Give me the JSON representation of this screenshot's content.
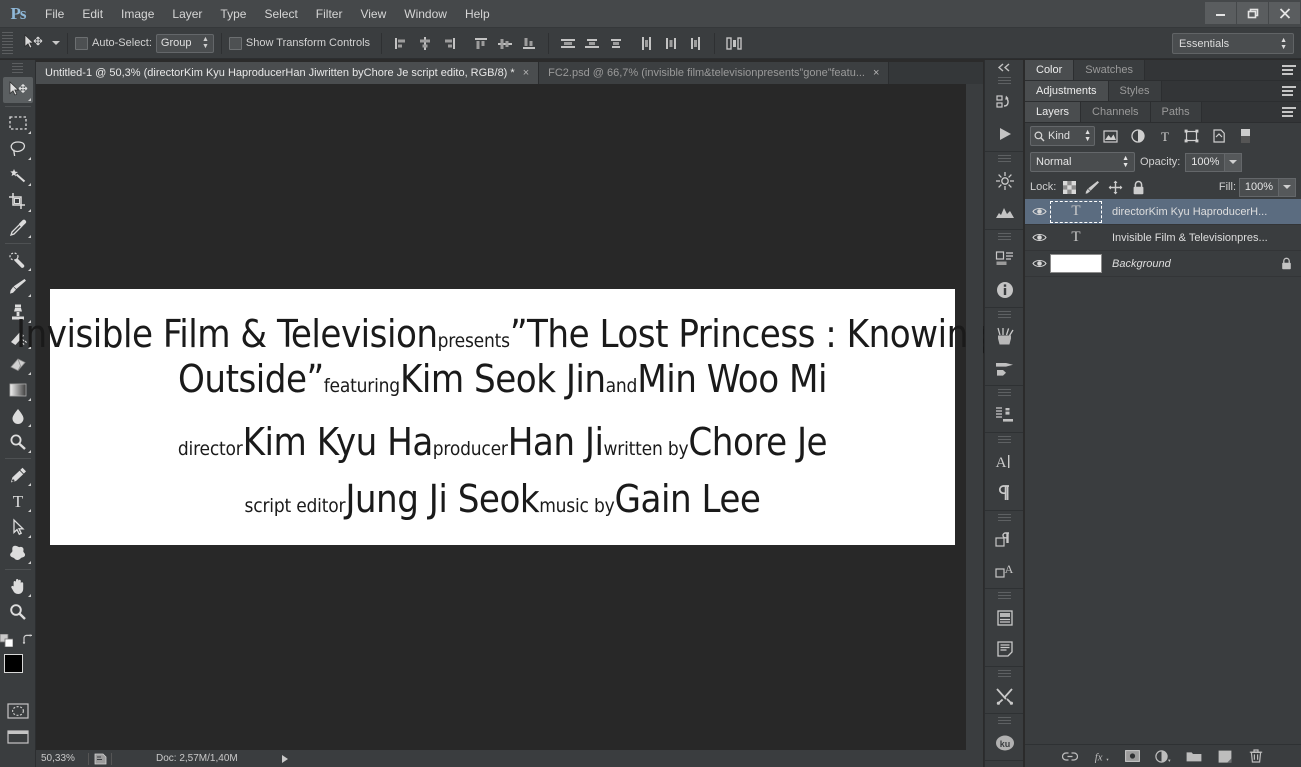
{
  "app": {
    "name": "Ps",
    "logo_text": "Ps"
  },
  "menubar": {
    "items": [
      "File",
      "Edit",
      "Image",
      "Layer",
      "Type",
      "Select",
      "Filter",
      "View",
      "Window",
      "Help"
    ]
  },
  "window_controls": {
    "minimize": "minimize-icon",
    "restore": "restore-icon",
    "close": "close-icon"
  },
  "options_bar": {
    "tool": "move-tool",
    "auto_select_label": "Auto-Select:",
    "auto_select_checked": false,
    "group_value": "Group",
    "show_transform_label": "Show Transform Controls",
    "show_transform_checked": false,
    "align_icons": [
      "align-left-edges-icon",
      "align-horizontal-centers-icon",
      "align-right-edges-icon",
      "align-top-edges-icon",
      "align-vertical-centers-icon",
      "align-bottom-edges-icon",
      "distribute-top-edges-icon",
      "distribute-vertical-centers-icon",
      "distribute-bottom-edges-icon",
      "distribute-left-edges-icon",
      "distribute-horizontal-centers-icon",
      "distribute-right-edges-icon",
      "auto-align-layers-icon"
    ],
    "workspace": "Essentials"
  },
  "tabs": [
    {
      "label": "Untitled-1 @ 50,3%  (directorKim Kyu HaproducerHan Jiwritten byChore Je script edito, RGB/8) *",
      "active": true,
      "close": "×"
    },
    {
      "label": "FC2.psd @ 66,7% (invisible film&televisionpresents”gone”featu...",
      "active": false,
      "close": "×"
    }
  ],
  "toolbar": {
    "tools": [
      {
        "name": "move-tool",
        "selected": true,
        "has_flyout": true
      },
      {
        "name": "rectangular-marquee-tool",
        "selected": false,
        "has_flyout": true
      },
      {
        "name": "lasso-tool",
        "selected": false,
        "has_flyout": true
      },
      {
        "name": "magic-wand-tool",
        "selected": false,
        "has_flyout": true
      },
      {
        "name": "crop-tool",
        "selected": false,
        "has_flyout": true
      },
      {
        "name": "eyedropper-tool",
        "selected": false,
        "has_flyout": true
      },
      {
        "name": "spot-healing-brush-tool",
        "selected": false,
        "has_flyout": true
      },
      {
        "name": "brush-tool",
        "selected": false,
        "has_flyout": true
      },
      {
        "name": "clone-stamp-tool",
        "selected": false,
        "has_flyout": true
      },
      {
        "name": "history-brush-tool",
        "selected": false,
        "has_flyout": true
      },
      {
        "name": "eraser-tool",
        "selected": false,
        "has_flyout": true
      },
      {
        "name": "gradient-tool",
        "selected": false,
        "has_flyout": true
      },
      {
        "name": "blur-tool",
        "selected": false,
        "has_flyout": true
      },
      {
        "name": "dodge-tool",
        "selected": false,
        "has_flyout": true
      },
      {
        "name": "pen-tool",
        "selected": false,
        "has_flyout": true
      },
      {
        "name": "horizontal-type-tool",
        "selected": false,
        "has_flyout": true
      },
      {
        "name": "path-selection-tool",
        "selected": false,
        "has_flyout": true
      },
      {
        "name": "custom-shape-tool",
        "selected": false,
        "has_flyout": true
      },
      {
        "name": "hand-tool",
        "selected": false,
        "has_flyout": true
      },
      {
        "name": "zoom-tool",
        "selected": false,
        "has_flyout": false
      }
    ],
    "foreground_color": "#000000",
    "background_color": "#ffffff",
    "quick_mask": "quick-mask-icon",
    "screen_mode": "screen-mode-icon"
  },
  "canvas": {
    "background_color": "#282828",
    "artboard_color": "#ffffff",
    "credits_lines": [
      [
        {
          "text": "Invisible Film & Television",
          "size": "big"
        },
        {
          "text": "presents",
          "size": "small"
        },
        {
          "text": "”The Lost Princess : Knowing",
          "size": "big"
        }
      ],
      [
        {
          "text": "Outside”",
          "size": "big"
        },
        {
          "text": "featuring",
          "size": "small"
        },
        {
          "text": "Kim Seok Jin",
          "size": "big"
        },
        {
          "text": "and",
          "size": "small"
        },
        {
          "text": "Min Woo Mi",
          "size": "big"
        }
      ],
      [
        {
          "text": "director",
          "size": "small"
        },
        {
          "text": "Kim Kyu Ha",
          "size": "big"
        },
        {
          "text": "producer",
          "size": "small"
        },
        {
          "text": "Han Ji",
          "size": "big"
        },
        {
          "text": "written by",
          "size": "small"
        },
        {
          "text": "Chore Je",
          "size": "big"
        }
      ],
      [
        {
          "text": "script editor",
          "size": "small"
        },
        {
          "text": "Jung Ji Seok",
          "size": "big"
        },
        {
          "text": "music by",
          "size": "small"
        },
        {
          "text": "Gain Lee",
          "size": "big"
        }
      ]
    ]
  },
  "statusbar": {
    "zoom": "50,33%",
    "doc_info": "Doc: 2,57M/1,40M"
  },
  "icon_dock": {
    "collapse": "collapse-panels-icon",
    "groups": [
      [
        "mini-bridge-icon",
        "timeline-play-icon"
      ],
      [
        "history-icon",
        "histogram-icon"
      ],
      [
        "properties-icon",
        "info-icon"
      ],
      [
        "brush-presets-icon",
        "brush-icon"
      ],
      [
        "clone-source-icon"
      ],
      [
        "character-icon",
        "paragraph-icon"
      ],
      [
        "character-styles-icon",
        "paragraph-styles-icon"
      ],
      [
        "layer-comps-icon",
        "notes-icon"
      ],
      [
        "tool-presets-icon"
      ],
      [
        "kuler-icon"
      ]
    ],
    "kuler_label": "ku"
  },
  "panels": {
    "color_group": {
      "tabs": [
        {
          "label": "Color",
          "active": true
        },
        {
          "label": "Swatches",
          "active": false
        }
      ]
    },
    "adjustments_group": {
      "tabs": [
        {
          "label": "Adjustments",
          "active": true
        },
        {
          "label": "Styles",
          "active": false
        }
      ]
    },
    "layers_group": {
      "tabs": [
        {
          "label": "Layers",
          "active": true
        },
        {
          "label": "Channels",
          "active": false
        },
        {
          "label": "Paths",
          "active": false
        }
      ]
    },
    "layers": {
      "filter_kind": "Kind",
      "filter_icons": [
        "filter-pixel-layers-icon",
        "filter-adjustment-layers-icon",
        "filter-type-layers-icon",
        "filter-shape-layers-icon",
        "filter-smart-objects-icon",
        "filter-toggle-icon"
      ],
      "blend_mode": "Normal",
      "opacity_label": "Opacity:",
      "opacity_value": "100%",
      "lock_label": "Lock:",
      "lock_icons": [
        "lock-transparent-pixels-icon",
        "lock-image-pixels-icon",
        "lock-position-icon",
        "lock-all-icon"
      ],
      "fill_label": "Fill:",
      "fill_value": "100%",
      "rows": [
        {
          "name": "directorKim Kyu HaproducerH...",
          "kind": "type",
          "thumb_char": "T",
          "selected": true,
          "visible": true,
          "locked": false,
          "italic": false
        },
        {
          "name": "Invisible Film & Televisionpres...",
          "kind": "type",
          "thumb_char": "T",
          "selected": false,
          "visible": true,
          "locked": false,
          "italic": false
        },
        {
          "name": "Background",
          "kind": "background",
          "thumb_char": "",
          "selected": false,
          "visible": true,
          "locked": true,
          "italic": true
        }
      ],
      "footer_icons": [
        "link-layers-icon",
        "layer-style-fx-icon",
        "add-layer-mask-icon",
        "new-fill-adjustment-layer-icon",
        "new-group-icon",
        "new-layer-icon",
        "delete-layer-icon"
      ]
    }
  },
  "colors": {
    "chrome": "#3a3d3f",
    "menubar": "#45484a",
    "canvas_bg": "#282828",
    "selection_blue": "#5b6c80",
    "accent_logo": "#8fb8d8"
  }
}
